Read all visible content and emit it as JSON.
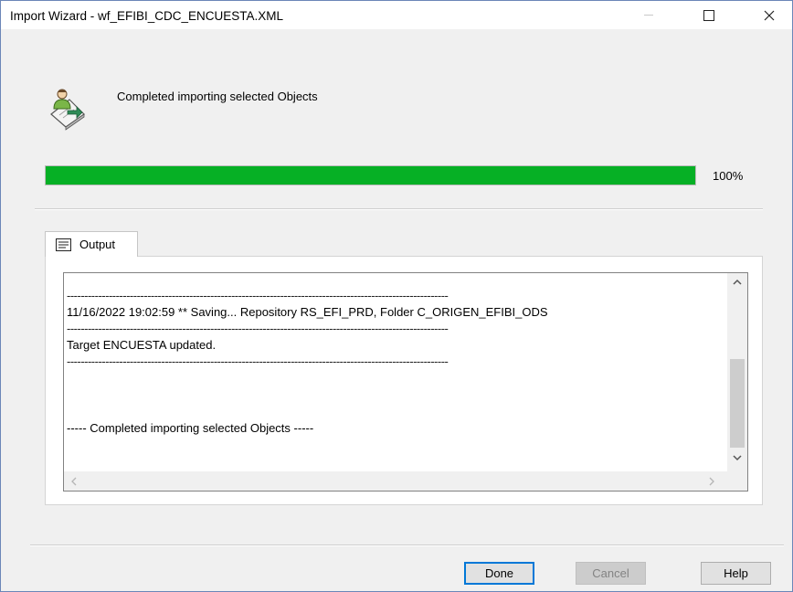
{
  "window": {
    "title": "Import Wizard - wf_EFIBI_CDC_ENCUESTA.XML",
    "controls": {
      "minimize_icon": "minimize-icon",
      "maximize_icon": "maximize-icon",
      "close_icon": "close-icon",
      "close_glyph": "✕"
    }
  },
  "status": {
    "icon": "import-wizard-icon",
    "message": "Completed importing selected Objects"
  },
  "progress": {
    "value": 1.0,
    "label": "100%",
    "color": "#06b025"
  },
  "output_tab": {
    "icon": "output-list-icon",
    "label": "Output",
    "lines": [
      {
        "kind": "dash",
        "text": "-------------------------------------------------------------------------------------------------------------"
      },
      {
        "kind": "text",
        "text": "11/16/2022 19:02:59 ** Saving... Repository RS_EFI_PRD, Folder C_ORIGEN_EFIBI_ODS"
      },
      {
        "kind": "dash",
        "text": "-------------------------------------------------------------------------------------------------------------"
      },
      {
        "kind": "text",
        "text": "Target ENCUESTA updated."
      },
      {
        "kind": "dash",
        "text": "-------------------------------------------------------------------------------------------------------------"
      },
      {
        "kind": "spacer",
        "text": ""
      },
      {
        "kind": "text",
        "text": "----- Completed importing selected Objects -----"
      }
    ]
  },
  "buttons": {
    "done": "Done",
    "cancel": "Cancel",
    "help": "Help"
  }
}
